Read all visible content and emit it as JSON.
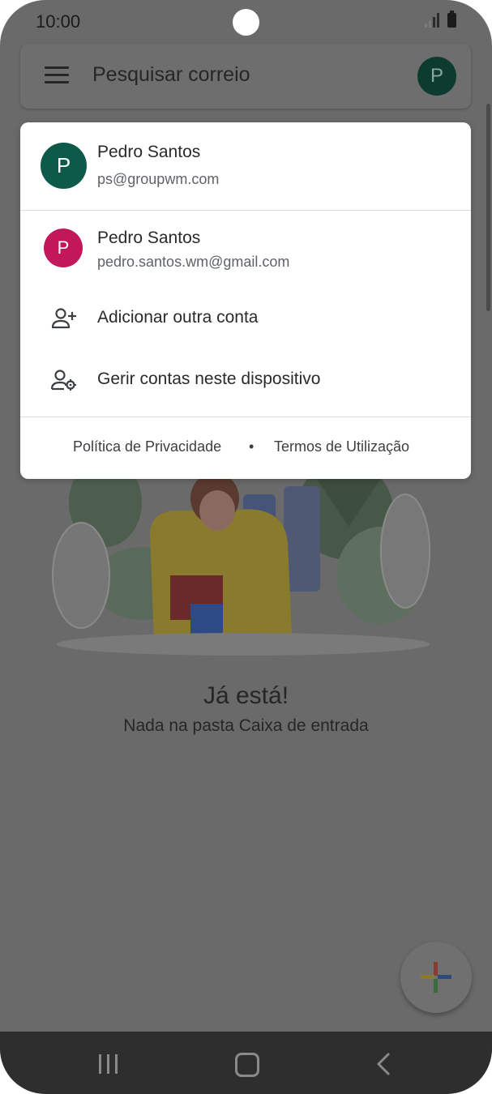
{
  "status_bar": {
    "time": "10:00"
  },
  "search": {
    "placeholder": "Pesquisar correio",
    "avatar_letter": "P"
  },
  "empty_state": {
    "title": "Já está!",
    "subtitle": "Nada na pasta Caixa de entrada"
  },
  "account_menu": {
    "primary": {
      "letter": "P",
      "name": "Pedro Santos",
      "email": "ps@groupwm.com"
    },
    "secondary": {
      "letter": "P",
      "name": "Pedro Santos",
      "email": "pedro.santos.wm@gmail.com"
    },
    "add_account_label": "Adicionar outra conta",
    "manage_accounts_label": "Gerir contas neste dispositivo",
    "footer": {
      "privacy": "Política de Privacidade",
      "separator": "•",
      "terms": "Termos de Utilização"
    }
  },
  "colors": {
    "scrim": "#6a6a6a",
    "primary_avatar": "#0e5a4a",
    "secondary_avatar": "#c2185b",
    "nav_bar": "#2e2e2e"
  },
  "icons": {
    "menu": "hamburger-icon",
    "add_account": "person-add-icon",
    "manage_accounts": "person-gear-icon",
    "compose": "plus-icon",
    "nav_recents": "recents-icon",
    "nav_home": "home-icon",
    "nav_back": "back-icon"
  }
}
